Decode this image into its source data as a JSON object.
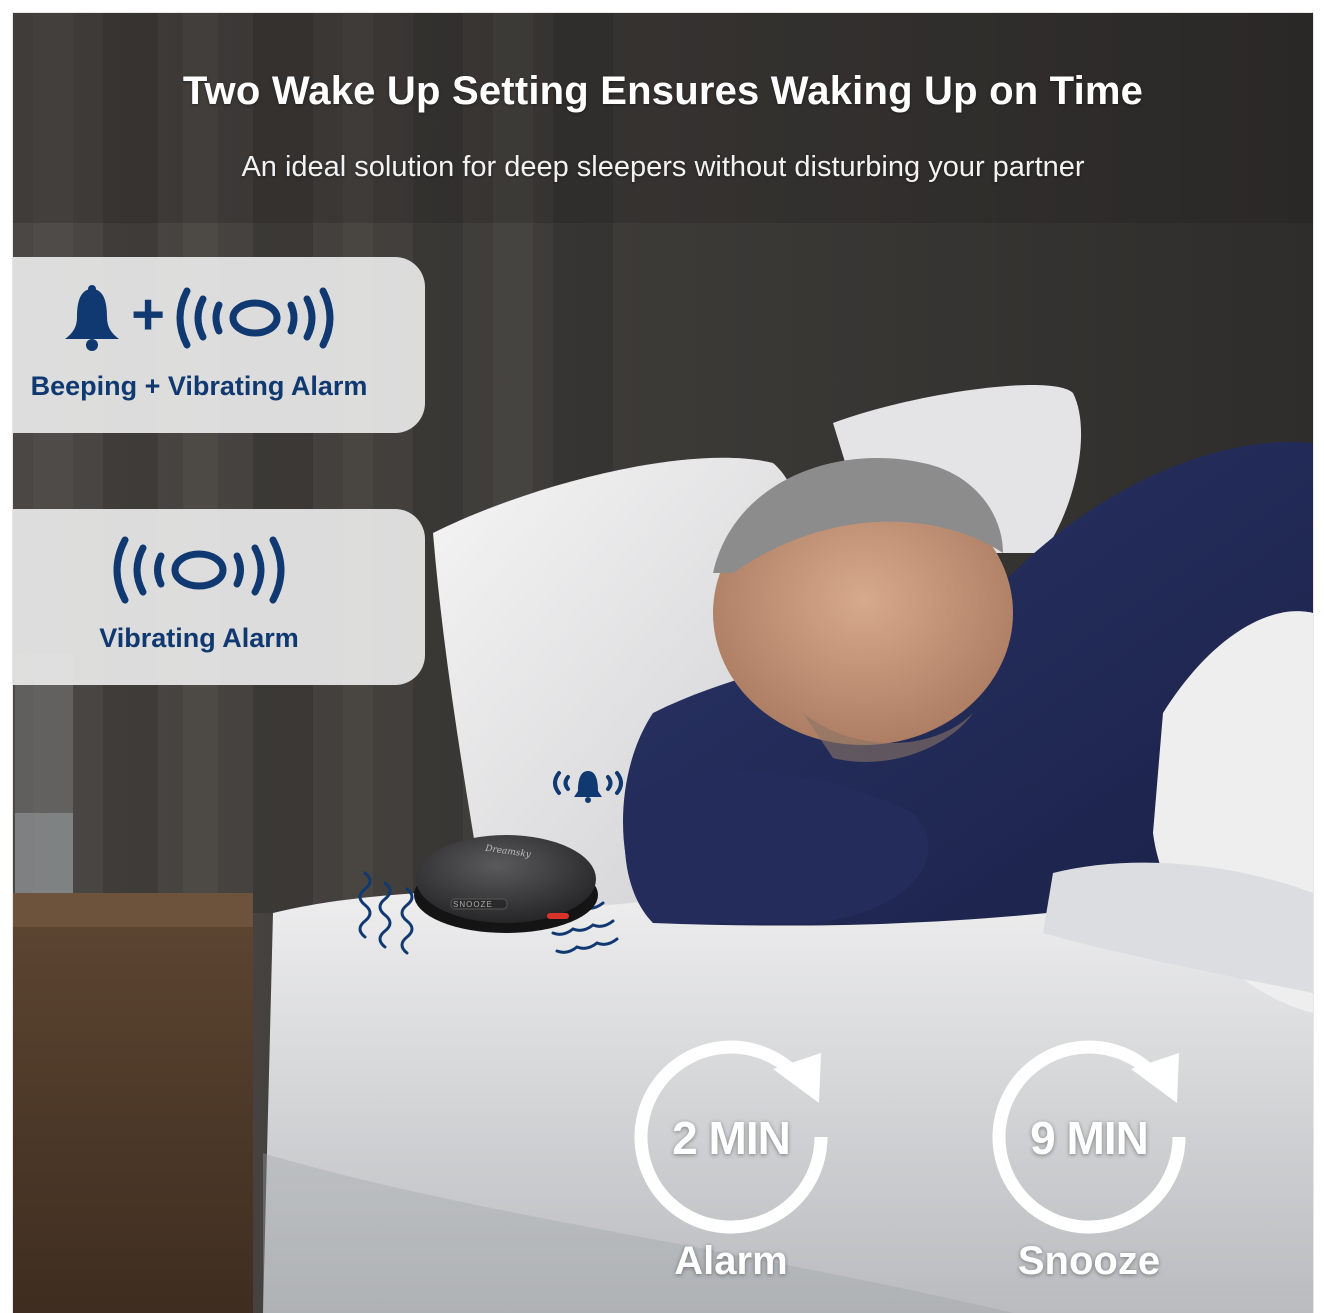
{
  "headline": "Two Wake Up Setting Ensures Waking Up on Time",
  "subheadline": "An ideal solution for deep sleepers without disturbing your partner",
  "modes": [
    {
      "icons": [
        "bell-icon",
        "plus-icon",
        "vibration-icon"
      ],
      "plus_glyph": "+",
      "label": "Beeping + Vibrating Alarm"
    },
    {
      "icons": [
        "vibration-icon"
      ],
      "label": "Vibrating Alarm"
    }
  ],
  "timers": [
    {
      "value": "2 MIN",
      "caption": "Alarm"
    },
    {
      "value": "9 MIN",
      "caption": "Snooze"
    }
  ],
  "device": {
    "brand_text": "Dreamsky",
    "button_text": "SNOOZE",
    "accent_color": "#d8332b"
  },
  "colors": {
    "icon_navy": "#0f3970",
    "card_bg": "#e8e8e8",
    "text_white": "#ffffff"
  }
}
